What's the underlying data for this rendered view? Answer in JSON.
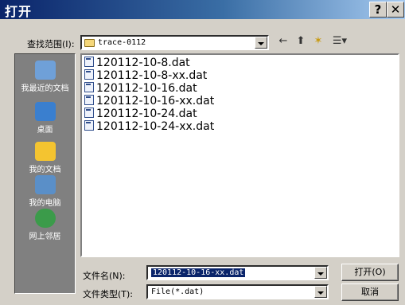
{
  "window": {
    "title": "打开",
    "help_btn": "?",
    "close_btn": "✕"
  },
  "lookin": {
    "label": "查找范围(I):",
    "value": "trace-0112"
  },
  "toolbar": {
    "back": "←",
    "up": "⬆",
    "new_folder": "✶",
    "views": "☰▾"
  },
  "places": [
    {
      "label": "我最近的文档",
      "icon": "recent-docs-icon",
      "color": "#6fa0d8"
    },
    {
      "label": "桌面",
      "icon": "desktop-icon",
      "color": "#3a7fcf"
    },
    {
      "label": "我的文档",
      "icon": "my-documents-icon",
      "color": "#f4c430"
    },
    {
      "label": "我的电脑",
      "icon": "my-computer-icon",
      "color": "#5a8fc8"
    },
    {
      "label": "网上邻居",
      "icon": "network-icon",
      "color": "#3b9b4a"
    }
  ],
  "files": [
    "120112-10-8.dat",
    "120112-10-8-xx.dat",
    "120112-10-16.dat",
    "120112-10-16-xx.dat",
    "120112-10-24.dat",
    "120112-10-24-xx.dat"
  ],
  "filename": {
    "label": "文件名(N):",
    "value": "120112-10-16-xx.dat"
  },
  "filetype": {
    "label": "文件类型(T):",
    "value": "File(*.dat)"
  },
  "buttons": {
    "open": "打开(O)",
    "cancel": "取消"
  }
}
